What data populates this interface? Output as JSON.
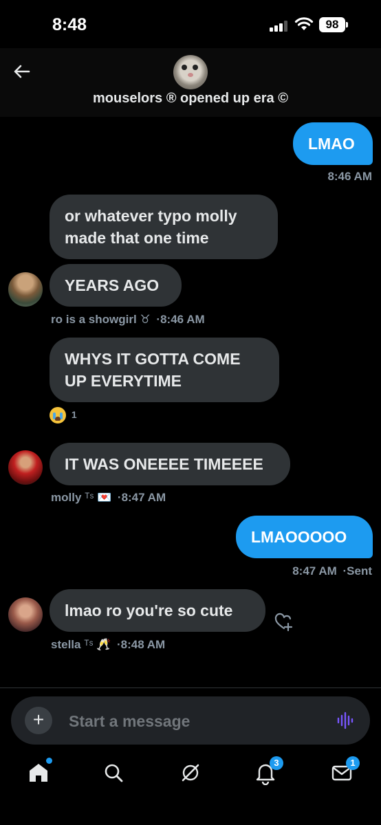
{
  "status_bar": {
    "time": "8:48",
    "battery": "98"
  },
  "header": {
    "group_name": "mouselors ® opened up era ©"
  },
  "messages": [
    {
      "text": "LMAO",
      "time": "8:46 AM"
    },
    {
      "text": "or whatever typo molly made that one time"
    },
    {
      "text": "YEARS AGO",
      "sender": "ro is a showgirl",
      "sender_extra": "♉︎",
      "time": "8:46 AM"
    },
    {
      "text": "WHYS IT GOTTA COME UP EVERYTIME",
      "reaction_count": "1"
    },
    {
      "text": "IT WAS ONEEEE TIMEEEE",
      "sender": "molly",
      "sender_extra": "ᵀˢ 💌",
      "time": "8:47 AM"
    },
    {
      "text": "LMAOOOOO",
      "time": "8:47 AM",
      "status": "Sent"
    },
    {
      "text": "lmao ro you're so cute",
      "sender": "stella",
      "sender_extra": "ᵀˢ 🥂",
      "time": "8:48 AM"
    }
  ],
  "composer": {
    "placeholder": "Start a message"
  },
  "tabbar": {
    "notifications_badge": "3",
    "messages_badge": "1"
  },
  "colors": {
    "accent": "#1d9bf0",
    "bubble_in": "#2f3336",
    "voice": "#7856ff"
  }
}
